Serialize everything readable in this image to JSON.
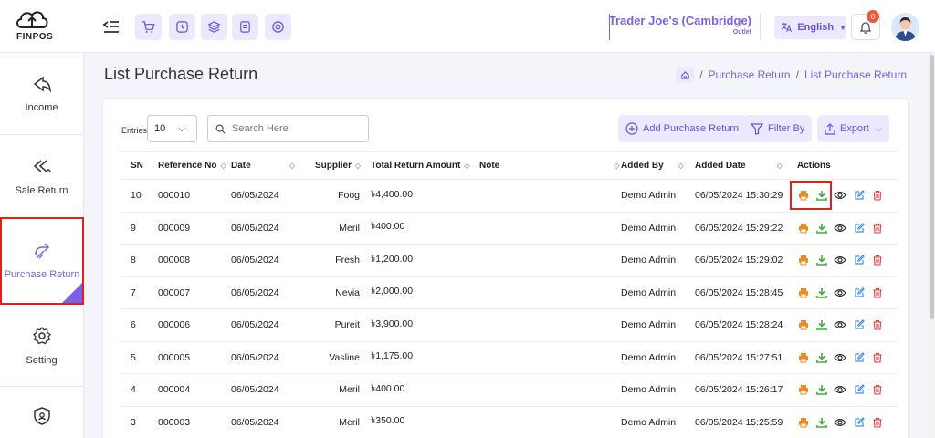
{
  "brand": {
    "logo_text": "FINPOS"
  },
  "header": {
    "store_name": "Trader Joe's (Cambridge)",
    "store_sub": "Outlet",
    "language": "English",
    "notification_count": "0"
  },
  "sidebar": {
    "items": [
      {
        "label": "Income",
        "icon": "income-icon"
      },
      {
        "label": "Sale Return",
        "icon": "sale-return-icon"
      },
      {
        "label": "Purchase Return",
        "icon": "purchase-return-icon",
        "active": true
      },
      {
        "label": "Setting",
        "icon": "gear-icon"
      },
      {
        "label": "",
        "icon": "shield-user-icon"
      }
    ]
  },
  "page": {
    "title": "List Purchase Return",
    "breadcrumb": [
      "Purchase Return",
      "List Purchase Return"
    ]
  },
  "toolbar": {
    "entries_label": "Entries",
    "entries_value": "10",
    "search_placeholder": "Search Here",
    "add_label": "Add Purchase Return",
    "filter_label": "Filter By",
    "export_label": "Export"
  },
  "table": {
    "columns": [
      "SN",
      "Reference No",
      "Date",
      "Supplier",
      "Total Return Amount",
      "Note",
      "Added By",
      "Added Date",
      "Actions"
    ],
    "rows": [
      {
        "sn": "10",
        "ref": "000010",
        "date": "06/05/2024",
        "supplier": "Foog",
        "amount": "৳4,400.00",
        "note": "",
        "added_by": "Demo Admin",
        "added_date": "06/05/2024 15:30:29"
      },
      {
        "sn": "9",
        "ref": "000009",
        "date": "06/05/2024",
        "supplier": "Meril",
        "amount": "৳400.00",
        "note": "",
        "added_by": "Demo Admin",
        "added_date": "06/05/2024 15:29:22"
      },
      {
        "sn": "8",
        "ref": "000008",
        "date": "06/05/2024",
        "supplier": "Fresh",
        "amount": "৳1,200.00",
        "note": "",
        "added_by": "Demo Admin",
        "added_date": "06/05/2024 15:29:02"
      },
      {
        "sn": "7",
        "ref": "000007",
        "date": "06/05/2024",
        "supplier": "Nevia",
        "amount": "৳2,000.00",
        "note": "",
        "added_by": "Demo Admin",
        "added_date": "06/05/2024 15:28:45"
      },
      {
        "sn": "6",
        "ref": "000006",
        "date": "06/05/2024",
        "supplier": "Pureit",
        "amount": "৳3,900.00",
        "note": "",
        "added_by": "Demo Admin",
        "added_date": "06/05/2024 15:28:24"
      },
      {
        "sn": "5",
        "ref": "000005",
        "date": "06/05/2024",
        "supplier": "Vasline",
        "amount": "৳1,175.00",
        "note": "",
        "added_by": "Demo Admin",
        "added_date": "06/05/2024 15:27:51"
      },
      {
        "sn": "4",
        "ref": "000004",
        "date": "06/05/2024",
        "supplier": "Meril",
        "amount": "৳400.00",
        "note": "",
        "added_by": "Demo Admin",
        "added_date": "06/05/2024 15:26:17"
      },
      {
        "sn": "3",
        "ref": "000003",
        "date": "06/05/2024",
        "supplier": "Meril",
        "amount": "৳350.00",
        "note": "",
        "added_by": "Demo Admin",
        "added_date": "06/05/2024 15:25:59"
      }
    ]
  },
  "colors": {
    "accent": "#7b61e8",
    "print": "#f08a1c",
    "download": "#3fae3f",
    "edit": "#3b8ff0",
    "delete": "#e53935",
    "highlight": "#e02020"
  }
}
